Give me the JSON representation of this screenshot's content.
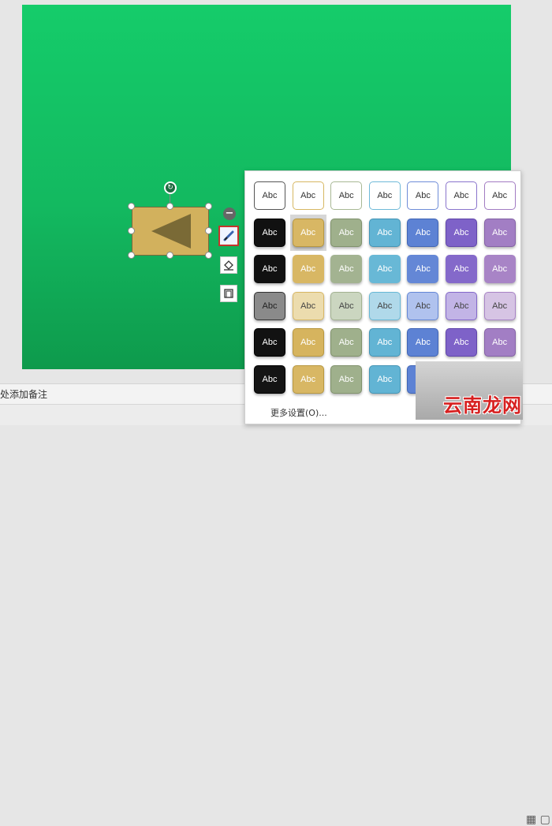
{
  "notes": {
    "placeholder": "处添加备注"
  },
  "style_panel": {
    "tile_text": "Abc",
    "more_label": "更多设置(O)...",
    "rows": [
      [
        {
          "bg": "#ffffff",
          "fg": "#333333",
          "bd": "#555555"
        },
        {
          "bg": "#ffffff",
          "fg": "#333333",
          "bd": "#d7b762"
        },
        {
          "bg": "#ffffff",
          "fg": "#333333",
          "bd": "#a8b894"
        },
        {
          "bg": "#ffffff",
          "fg": "#333333",
          "bd": "#6fb9d8"
        },
        {
          "bg": "#ffffff",
          "fg": "#333333",
          "bd": "#6e8cd8"
        },
        {
          "bg": "#ffffff",
          "fg": "#333333",
          "bd": "#8a74cc"
        },
        {
          "bg": "#ffffff",
          "fg": "#333333",
          "bd": "#a27bc2"
        }
      ],
      [
        {
          "bg": "#111111",
          "fg": "#ffffff",
          "bd": "#000000"
        },
        {
          "bg": "#d8b764",
          "fg": "#ffffff",
          "bd": "#b89840"
        },
        {
          "bg": "#9fb08c",
          "fg": "#ffffff",
          "bd": "#80926c"
        },
        {
          "bg": "#62b4d4",
          "fg": "#ffffff",
          "bd": "#4495b6"
        },
        {
          "bg": "#5d82d4",
          "fg": "#ffffff",
          "bd": "#4065b6"
        },
        {
          "bg": "#7e62c8",
          "fg": "#ffffff",
          "bd": "#6046aa"
        },
        {
          "bg": "#a27ec4",
          "fg": "#ffffff",
          "bd": "#8462a6"
        }
      ],
      [
        {
          "bg": "#111111",
          "fg": "#ffffff",
          "bd": "#111111"
        },
        {
          "bg": "#d8b764",
          "fg": "#ffffff",
          "bd": "#d8b764"
        },
        {
          "bg": "#a3b391",
          "fg": "#ffffff",
          "bd": "#a3b391"
        },
        {
          "bg": "#68b8d6",
          "fg": "#ffffff",
          "bd": "#68b8d6"
        },
        {
          "bg": "#6487d6",
          "fg": "#ffffff",
          "bd": "#6487d6"
        },
        {
          "bg": "#8469ca",
          "fg": "#ffffff",
          "bd": "#8469ca"
        },
        {
          "bg": "#a884c6",
          "fg": "#ffffff",
          "bd": "#a884c6"
        }
      ],
      [
        {
          "bg": "#8a8a8a",
          "fg": "#222222",
          "bd": "#333333"
        },
        {
          "bg": "#ecdcae",
          "fg": "#444444",
          "bd": "#d8b764"
        },
        {
          "bg": "#cbd6c0",
          "fg": "#444444",
          "bd": "#a3b391"
        },
        {
          "bg": "#b0d9ea",
          "fg": "#444444",
          "bd": "#68b8d6"
        },
        {
          "bg": "#b0c2ee",
          "fg": "#444444",
          "bd": "#6487d6"
        },
        {
          "bg": "#c2b4e6",
          "fg": "#444444",
          "bd": "#8469ca"
        },
        {
          "bg": "#d6c4e4",
          "fg": "#444444",
          "bd": "#a884c6"
        }
      ],
      [
        {
          "bg": "#121212",
          "fg": "#ffffff",
          "bd": "#000000"
        },
        {
          "bg": "#d6b45e",
          "fg": "#ffffff",
          "bd": "#b89840"
        },
        {
          "bg": "#9fb08c",
          "fg": "#ffffff",
          "bd": "#80926c"
        },
        {
          "bg": "#62b4d4",
          "fg": "#ffffff",
          "bd": "#4495b6"
        },
        {
          "bg": "#5d82d4",
          "fg": "#ffffff",
          "bd": "#4065b6"
        },
        {
          "bg": "#7e62c8",
          "fg": "#ffffff",
          "bd": "#6046aa"
        },
        {
          "bg": "#a27ec4",
          "fg": "#ffffff",
          "bd": "#8462a6"
        }
      ],
      [
        {
          "bg": "#141414",
          "fg": "#ffffff",
          "bd": "#000000"
        },
        {
          "bg": "#d8b764",
          "fg": "#ffffff",
          "bd": "#b89840"
        },
        {
          "bg": "#9fb08c",
          "fg": "#ffffff",
          "bd": "#80926c"
        },
        {
          "bg": "#62b4d4",
          "fg": "#ffffff",
          "bd": "#4495b6"
        },
        {
          "bg": "#5d82d4",
          "fg": "#ffffff",
          "bd": "#4065b6"
        }
      ]
    ]
  },
  "shape": {
    "fill": "#d2b15d",
    "triangle": "#7a6a36"
  },
  "watermark": {
    "text": "云南龙网"
  }
}
